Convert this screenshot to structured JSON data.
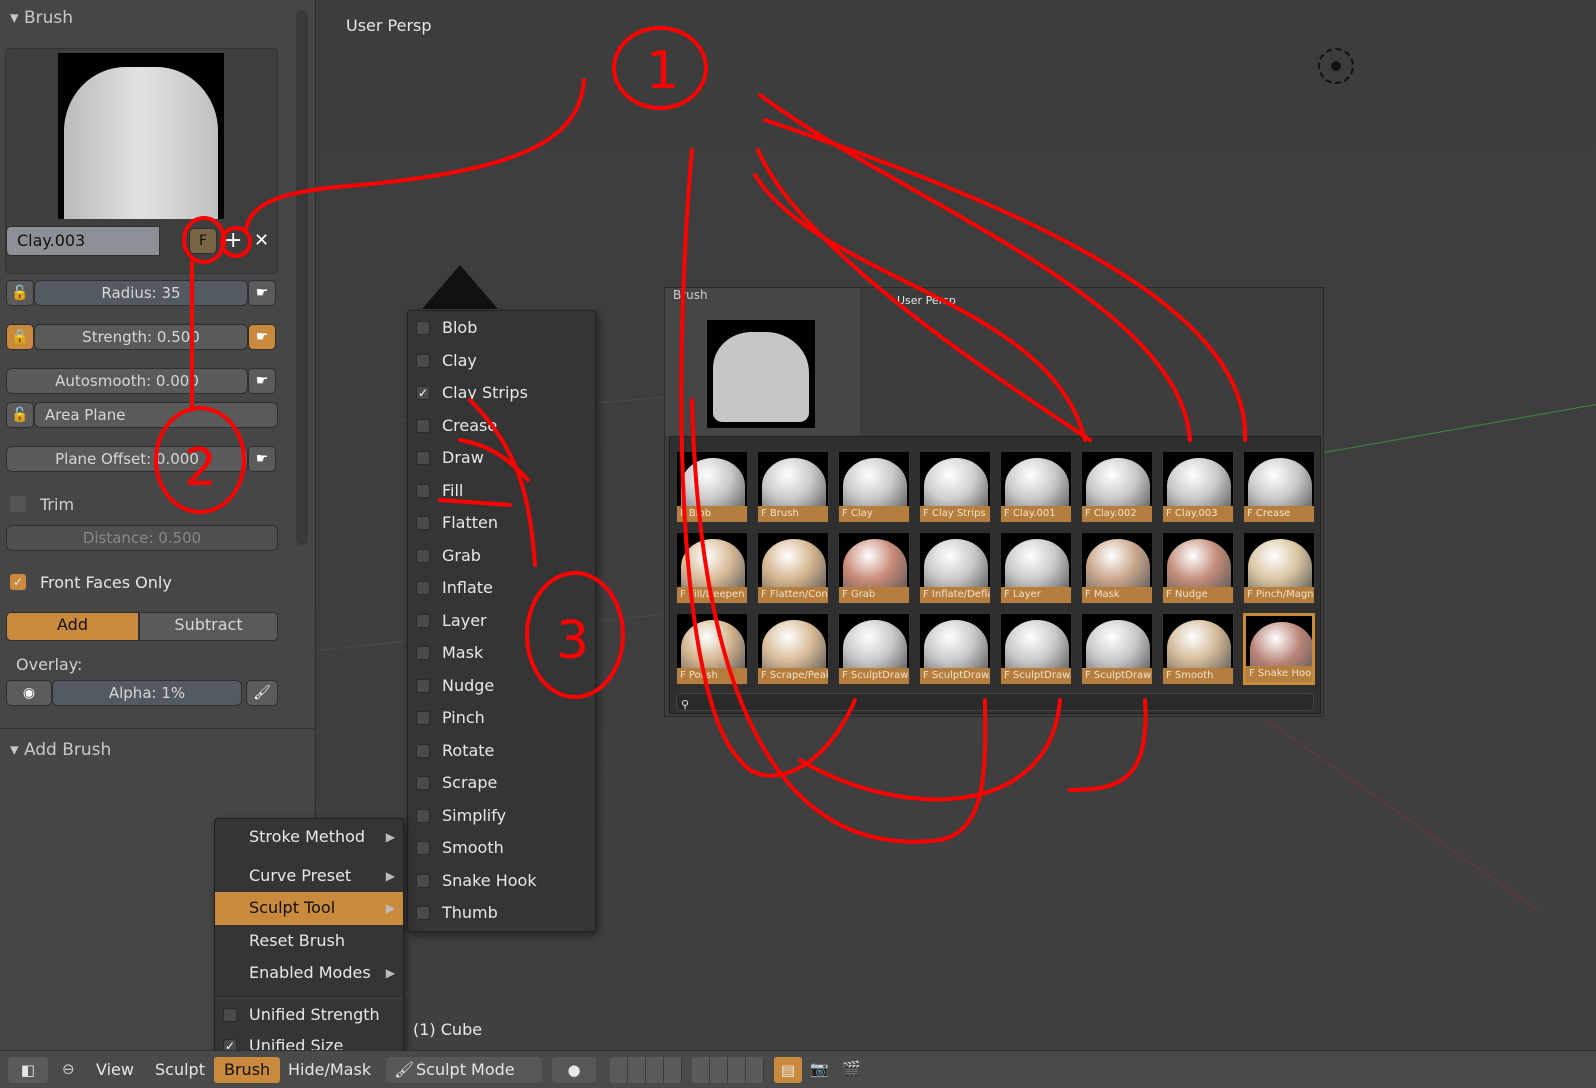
{
  "left_panel": {
    "brush_header": "Brush",
    "brush_name": "Clay.003",
    "fake_user_label": "F",
    "radius": "Radius: 35",
    "strength": "Strength: 0.500",
    "autosmooth": "Autosmooth: 0.000",
    "area_plane": "Area Plane",
    "plane_offset": "Plane Offset: 0.000",
    "trim": "Trim",
    "distance": "Distance: 0.500",
    "front_faces_only": "Front Faces Only",
    "add": "Add",
    "subtract": "Subtract",
    "overlay_label": "Overlay:",
    "alpha": "Alpha: 1%",
    "add_brush_header": "Add Brush"
  },
  "viewport": {
    "label": "User Persp",
    "object_label": "(1) Cube"
  },
  "brush_menu": {
    "items": [
      {
        "label": "Stroke Method",
        "submenu": true
      },
      {
        "label": "Curve Preset",
        "submenu": true
      },
      {
        "label": "Sculpt Tool",
        "submenu": true,
        "active": true
      },
      {
        "label": "Reset Brush"
      },
      {
        "label": "Enabled Modes",
        "submenu": true
      },
      {
        "label": "Unified Strength",
        "checkbox": true,
        "checked": false
      },
      {
        "label": "Unified Size",
        "checkbox": true,
        "checked": true
      }
    ]
  },
  "sculpt_tool_menu": {
    "items": [
      {
        "label": "Blob",
        "checked": false
      },
      {
        "label": "Clay",
        "checked": false
      },
      {
        "label": "Clay Strips",
        "checked": true
      },
      {
        "label": "Crease",
        "checked": false
      },
      {
        "label": "Draw",
        "checked": false
      },
      {
        "label": "Fill",
        "checked": false
      },
      {
        "label": "Flatten",
        "checked": false
      },
      {
        "label": "Grab",
        "checked": false
      },
      {
        "label": "Inflate",
        "checked": false
      },
      {
        "label": "Layer",
        "checked": false
      },
      {
        "label": "Mask",
        "checked": false
      },
      {
        "label": "Nudge",
        "checked": false
      },
      {
        "label": "Pinch",
        "checked": false
      },
      {
        "label": "Rotate",
        "checked": false
      },
      {
        "label": "Scrape",
        "checked": false
      },
      {
        "label": "Simplify",
        "checked": false
      },
      {
        "label": "Smooth",
        "checked": false
      },
      {
        "label": "Snake Hook",
        "checked": false
      },
      {
        "label": "Thumb",
        "checked": false
      }
    ]
  },
  "inset": {
    "brush_header": "Brush",
    "viewport_label": "User Persp",
    "thumbnails": [
      {
        "label": "F Blob",
        "color": "#c9c9c9"
      },
      {
        "label": "F Brush",
        "color": "#c9c9c9"
      },
      {
        "label": "F Clay",
        "color": "#c9c9c9"
      },
      {
        "label": "F Clay Strips",
        "color": "#cfcfcf"
      },
      {
        "label": "F Clay.001",
        "color": "#c9c9c9"
      },
      {
        "label": "F Clay.002",
        "color": "#c9c9c9"
      },
      {
        "label": "F Clay.003",
        "color": "#c9c9c9"
      },
      {
        "label": "F Crease",
        "color": "#c9c9c9"
      },
      {
        "label": "F Fill/Deepen",
        "color": "#d8bb98"
      },
      {
        "label": "F Flatten/Cont",
        "color": "#d4b58f"
      },
      {
        "label": "F Grab",
        "color": "#c98a78"
      },
      {
        "label": "F Inflate/Defla",
        "color": "#c9c9c9"
      },
      {
        "label": "F Layer",
        "color": "#c9c9c9"
      },
      {
        "label": "F Mask",
        "color": "#c9a68c"
      },
      {
        "label": "F Nudge",
        "color": "#c48c7c"
      },
      {
        "label": "F Pinch/Magni",
        "color": "#d8c4a0"
      },
      {
        "label": "F Polish",
        "color": "#d4b58f"
      },
      {
        "label": "F Scrape/Peak",
        "color": "#d8bb98"
      },
      {
        "label": "F SculptDraw",
        "color": "#c9c9c9"
      },
      {
        "label": "F SculptDraw.",
        "color": "#c9c9c9"
      },
      {
        "label": "F SculptDraw.",
        "color": "#c9c9c9"
      },
      {
        "label": "F SculptDraw",
        "color": "#c9c9c9"
      },
      {
        "label": "F Smooth",
        "color": "#d2b998"
      },
      {
        "label": "F Snake Hook",
        "color": "#b98478"
      }
    ],
    "selected_index": 23
  },
  "bottom_bar": {
    "view": "View",
    "sculpt": "Sculpt",
    "brush": "Brush",
    "hide_mask": "Hide/Mask",
    "mode": "Sculpt Mode"
  },
  "annotations": [
    "1",
    "2",
    "3"
  ],
  "colors": {
    "accent": "#c98a3e",
    "annotation": "#ff0000"
  }
}
